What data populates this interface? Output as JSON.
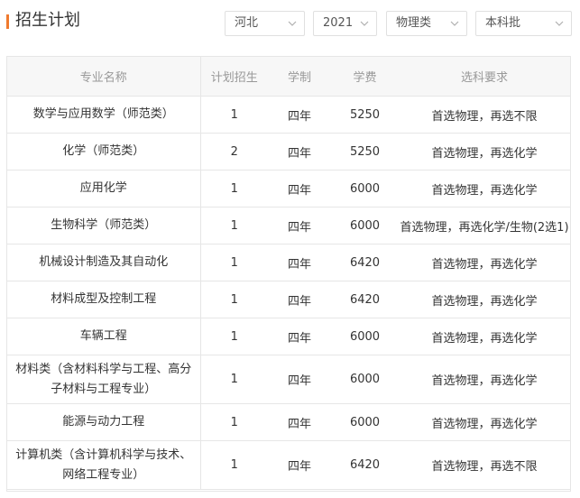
{
  "header": {
    "title": "招生计划",
    "filters": {
      "province": "河北",
      "year": "2021",
      "subject": "物理类",
      "batch": "本科批"
    },
    "accent_color": "#f07a2e"
  },
  "table": {
    "columns": [
      "专业名称",
      "计划招生",
      "学制",
      "学费",
      "选科要求"
    ],
    "rows": [
      {
        "major": "数学与应用数学（师范类）",
        "plan": "1",
        "years": "四年",
        "fee": "5250",
        "req": "首选物理，再选不限"
      },
      {
        "major": "化学（师范类）",
        "plan": "2",
        "years": "四年",
        "fee": "5250",
        "req": "首选物理，再选化学"
      },
      {
        "major": "应用化学",
        "plan": "1",
        "years": "四年",
        "fee": "6000",
        "req": "首选物理，再选化学"
      },
      {
        "major": "生物科学（师范类）",
        "plan": "1",
        "years": "四年",
        "fee": "6000",
        "req": "首选物理，再选化学/生物(2选1)"
      },
      {
        "major": "机械设计制造及其自动化",
        "plan": "1",
        "years": "四年",
        "fee": "6420",
        "req": "首选物理，再选化学"
      },
      {
        "major": "材料成型及控制工程",
        "plan": "1",
        "years": "四年",
        "fee": "6420",
        "req": "首选物理，再选化学"
      },
      {
        "major": "车辆工程",
        "plan": "1",
        "years": "四年",
        "fee": "6000",
        "req": "首选物理，再选化学"
      },
      {
        "major": "材料类（含材料科学与工程、高分子材料与工程专业）",
        "plan": "1",
        "years": "四年",
        "fee": "6000",
        "req": "首选物理，再选化学"
      },
      {
        "major": "能源与动力工程",
        "plan": "1",
        "years": "四年",
        "fee": "6000",
        "req": "首选物理，再选化学"
      },
      {
        "major": "计算机类（含计算机科学与技术、网络工程专业）",
        "plan": "1",
        "years": "四年",
        "fee": "6420",
        "req": "首选物理，再选不限"
      }
    ]
  }
}
